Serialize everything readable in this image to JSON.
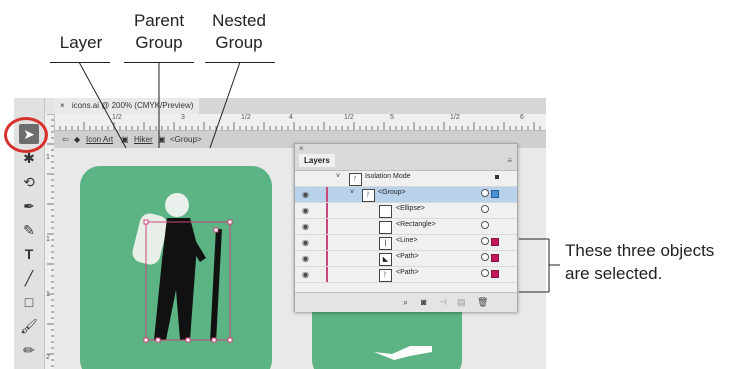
{
  "callouts": {
    "layer": "Layer",
    "parent_group": [
      "Parent",
      "Group"
    ],
    "nested_group": [
      "Nested",
      "Group"
    ]
  },
  "document_tab": {
    "close_glyph": "×",
    "title": "icons.ai @ 200% (CMYK/Preview)"
  },
  "isolation_bar": {
    "layer": "Icon Art",
    "parent": "Hiker",
    "nested": "<Group>"
  },
  "ruler": {
    "horizontal_labels": [
      "1/2",
      "3",
      "1/2",
      "4",
      "1/2",
      "5",
      "1/2",
      "6"
    ],
    "vertical_labels": [
      "1",
      "1",
      "1",
      "2"
    ]
  },
  "layers_panel": {
    "tab_label": "Layers",
    "rows": [
      {
        "name": "Isolation Mode",
        "selected": false,
        "visible": false
      },
      {
        "name": "<Group>",
        "selected": true,
        "visible": true
      },
      {
        "name": "<Ellipse>",
        "selected": false,
        "visible": true
      },
      {
        "name": "<Rectangle>",
        "selected": false,
        "visible": true
      },
      {
        "name": "<Line>",
        "selected": false,
        "visible": true
      },
      {
        "name": "<Path>",
        "selected": false,
        "visible": true
      },
      {
        "name": "<Path>",
        "selected": false,
        "visible": true
      }
    ]
  },
  "annotation": {
    "selected_note": "These three objects are selected."
  },
  "colors": {
    "tile_green": "#5cb383",
    "selection_magenta": "#c9477b",
    "highlight_red": "#d8302a",
    "row_selected": "#b8d2ec"
  },
  "icons": [
    "selection-tool-icon",
    "eye-icon",
    "search-icon",
    "trash-icon",
    "layer-icon",
    "disclosure-triangle-icon"
  ]
}
